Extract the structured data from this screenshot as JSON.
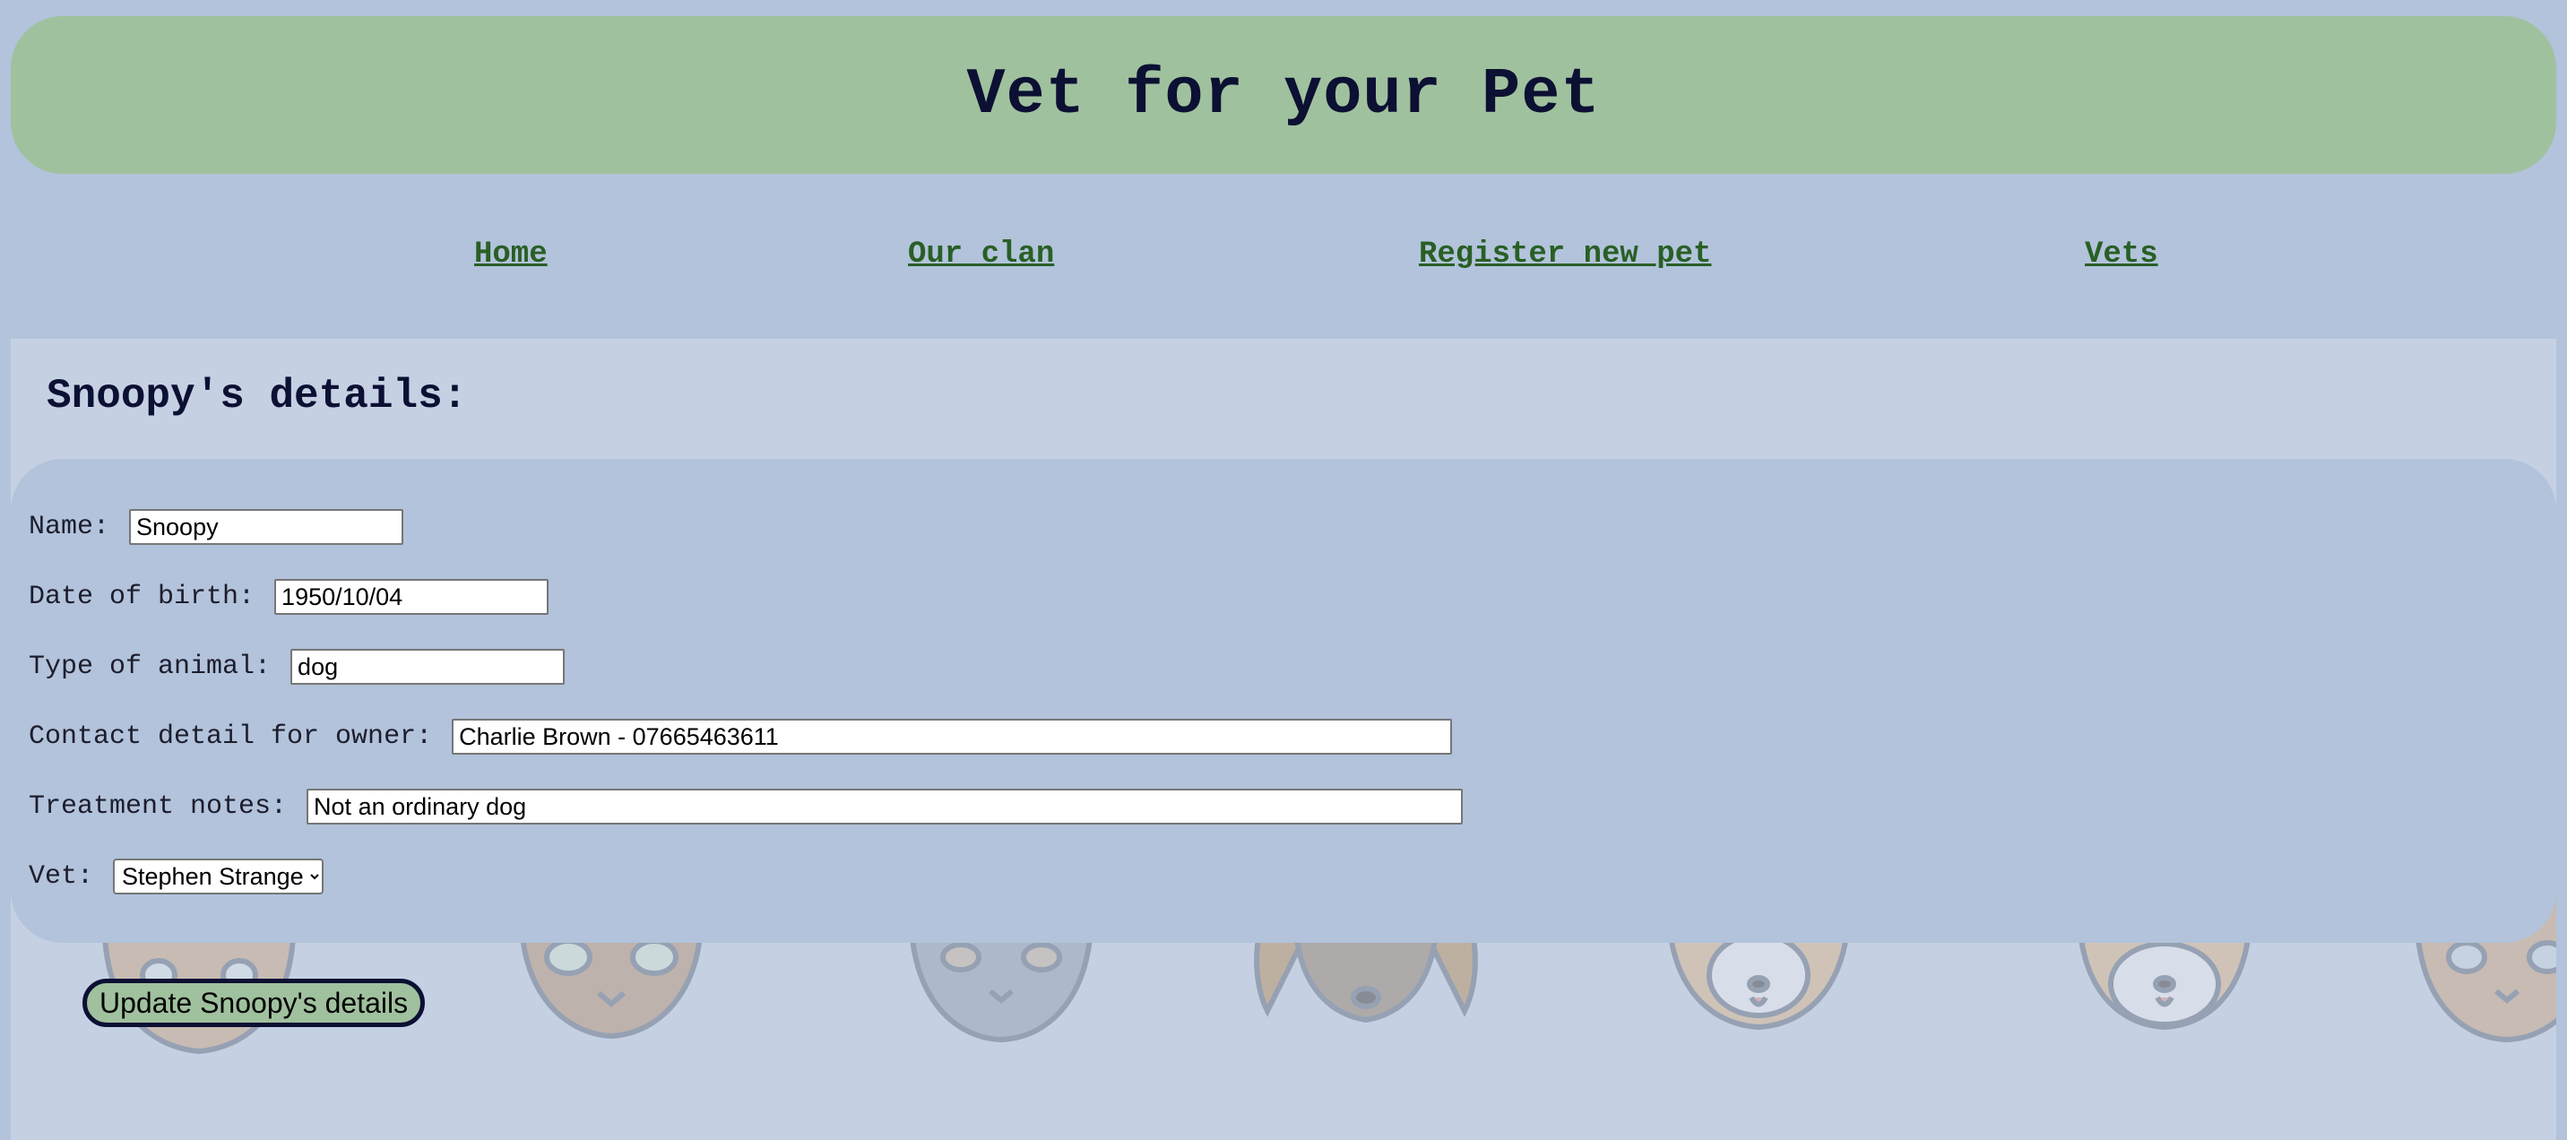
{
  "header": {
    "title": "Vet for your Pet"
  },
  "nav": {
    "home": "Home",
    "our_clan": "Our clan",
    "register": "Register new pet",
    "vets": "Vets"
  },
  "page": {
    "heading": "Snoopy's details:"
  },
  "form": {
    "name_label": "Name:",
    "name_value": "Snoopy",
    "dob_label": "Date of birth:",
    "dob_value": "1950/10/04",
    "type_label": "Type of animal:",
    "type_value": "dog",
    "contact_label": "Contact detail for owner:",
    "contact_value": "Charlie Brown - 07665463611",
    "notes_label": "Treatment notes:",
    "notes_value": "Not an ordinary dog",
    "vet_label": "Vet:",
    "vet_selected": "Stephen Strange",
    "submit_label": "Update Snoopy's details"
  },
  "colors": {
    "background": "#b2c3db",
    "header": "#a0c19e",
    "nav_link": "#295f25",
    "content": "#c5d1e3",
    "title_text": "#0c1033"
  }
}
